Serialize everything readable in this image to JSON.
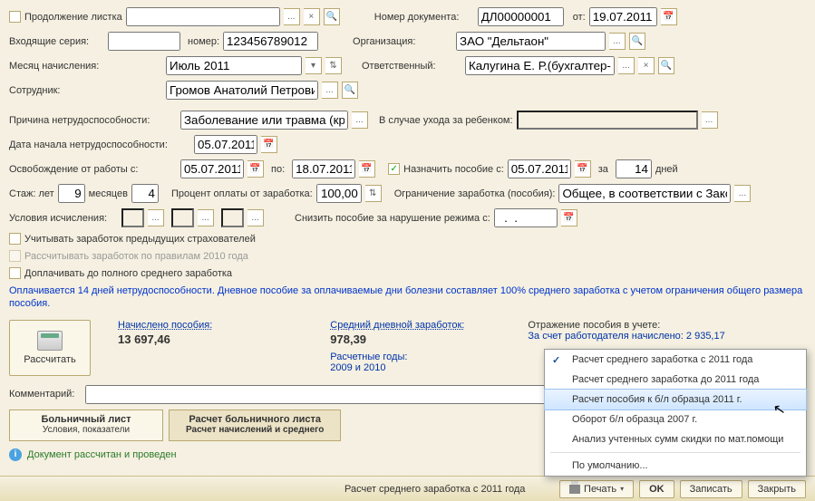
{
  "header": {
    "cont_label": "Продолжение листка",
    "cont_value": "",
    "doc_no_label": "Номер документа:",
    "doc_no": "ДЛ00000001",
    "from_label": "от:",
    "from_date": "19.07.2011",
    "in_series_label": "Входящие серия:",
    "in_series": "",
    "in_no_label": "номер:",
    "in_no": "123456789012",
    "org_label": "Организация:",
    "org": "ЗАО \"Дельтаон\"",
    "month_label": "Месяц начисления:",
    "month": "Июль 2011",
    "resp_label": "Ответственный:",
    "resp": "Калугина Е. Р.(бухгалтер-рас",
    "emp_label": "Сотрудник:",
    "emp": "Громов Анатолий Петрович"
  },
  "body": {
    "reason_label": "Причина нетрудоспособности:",
    "reason": "Заболевание или травма (кроме",
    "childcare_label": "В случае ухода за ребенком:",
    "childcare": "",
    "start_label": "Дата начала нетрудоспособности:",
    "start": "05.07.2011",
    "free_from_label": "Освобождение от работы с:",
    "free_from": "05.07.2011",
    "to_label": "по:",
    "free_to": "18.07.2011",
    "assign_label": "Назначить пособие с:",
    "assign_from": "05.07.2011",
    "for_label": "за",
    "days": "14",
    "days_label": "дней",
    "exp_label": "Стаж: лет",
    "exp_years": "9",
    "exp_months_label": "месяцев",
    "exp_months": "4",
    "pay_pct_label": "Процент оплаты от заработка:",
    "pay_pct": "100,00",
    "limit_label": "Ограничение заработка (пособия):",
    "limit": "Общее, в соответствии с Закон",
    "cond_label": "Условия исчисления:",
    "reduce_label": "Снизить пособие за нарушение режима с:",
    "reduce": "  .  .    ",
    "chk_prev": "Учитывать заработок предыдущих страхователей",
    "chk_2010": "Рассчитывать заработок по правилам 2010 года",
    "chk_full": "Доплачивать до полного среднего заработка",
    "info": "Оплачивается 14 дней нетрудоспособности.  Дневное пособие за оплачиваемые дни болезни составляет 100% среднего заработка с учетом ограничения общего размера пособия."
  },
  "calc": {
    "btn": "Рассчитать",
    "accrued_hd": "Начислено пособия:",
    "accrued": "13 697,46",
    "avg_hd": "Средний дневной заработок:",
    "avg": "978,39",
    "years_hd": "Расчетные годы:",
    "years": "2009 и 2010",
    "reflect_hd": "Отражение пособия в учете:",
    "reflect": "За счет работодателя начислено: 2 935,17"
  },
  "comment_label": "Комментарий:",
  "comment": "",
  "tabs": {
    "t1a": "Больничный лист",
    "t1b": "Условия, показатели",
    "t2a": "Расчет больничного листа",
    "t2b": "Расчет начислений и среднего"
  },
  "status": "Документ рассчитан и проведен",
  "bottom": {
    "current": "Расчет среднего заработка с 2011 года",
    "print": "Печать",
    "ok": "OK",
    "save": "Записать",
    "close": "Закрыть"
  },
  "menu": {
    "i1": "Расчет среднего заработка с 2011 года",
    "i2": "Расчет среднего заработка до 2011 года",
    "i3": "Расчет пособия к б/л образца 2011 г.",
    "i4": "Оборот б/л образца 2007 г.",
    "i5": "Анализ учтенных сумм скидки по мат.помощи",
    "i6": "По умолчанию..."
  },
  "glyphs": {
    "dots": "...",
    "x": "×",
    "mag": "🔍",
    "cal": "📅",
    "dd": "▾",
    "spin": "⇅",
    "check": "✓"
  }
}
